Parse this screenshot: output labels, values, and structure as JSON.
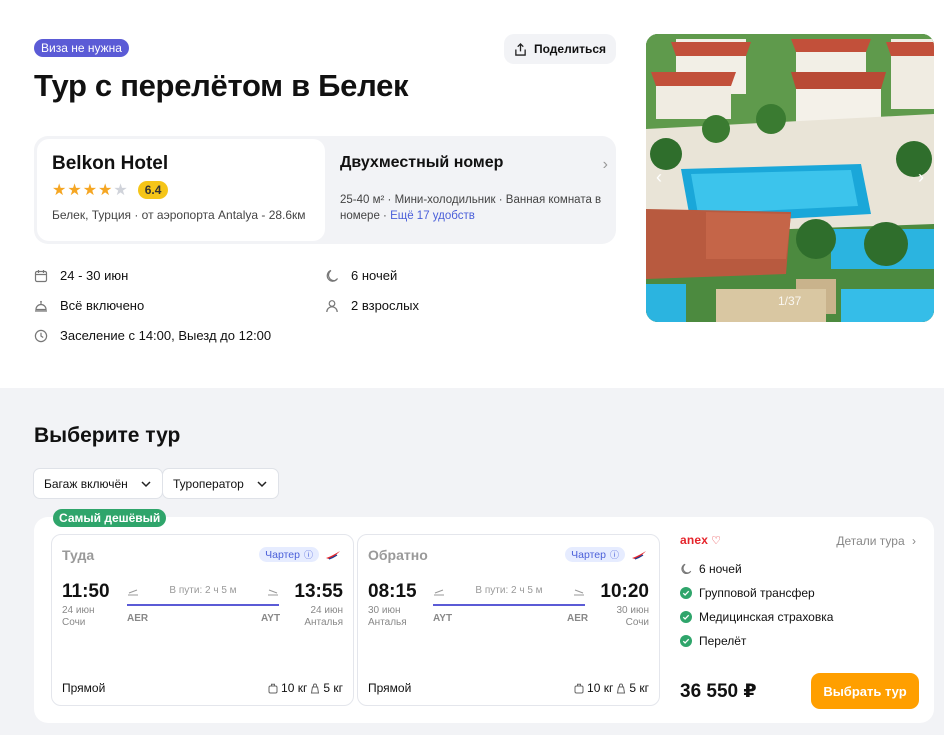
{
  "header": {
    "visa_badge": "Виза не нужна",
    "share_label": "Поделиться",
    "title": "Тур с перелётом в Белек"
  },
  "hotel": {
    "name": "Belkon Hotel",
    "stars": 4,
    "score": "6.4",
    "location": "Белек, Турция · от аэропорта Antalya - 28.6км"
  },
  "room": {
    "title": "Двухместный номер",
    "features": "25-40 м² · Мини-холодильник · Ванная комната в номере ·",
    "more_link": "Ещё 17 удобств"
  },
  "facts": {
    "dates": "24 - 30 июн",
    "nights": "6 ночей",
    "meals": "Всё включено",
    "guests": "2 взрослых",
    "checkin": "Заселение с 14:00, Выезд до 12:00"
  },
  "gallery": {
    "counter": "1/37"
  },
  "tours": {
    "section_title": "Выберите тур",
    "filters": [
      "Багаж включён",
      "Туроператор"
    ],
    "cheapest_badge": "Самый дешёвый",
    "legs": [
      {
        "heading": "Туда",
        "charter": "Чартер",
        "dep_time": "11:50",
        "dep_date": "24 июн",
        "dep_city": "Сочи",
        "dep_code": "AER",
        "duration": "В пути: 2 ч 5 м",
        "arr_time": "13:55",
        "arr_date": "24 июн",
        "arr_city": "Анталья",
        "arr_code": "AYT",
        "type": "Прямой",
        "bag_checked": "10 кг",
        "bag_hand": "5 кг"
      },
      {
        "heading": "Обратно",
        "charter": "Чартер",
        "dep_time": "08:15",
        "dep_date": "30 июн",
        "dep_city": "Анталья",
        "dep_code": "AYT",
        "duration": "В пути: 2 ч 5 м",
        "arr_time": "10:20",
        "arr_date": "30 июн",
        "arr_city": "Сочи",
        "arr_code": "AER",
        "type": "Прямой",
        "bag_checked": "10 кг",
        "bag_hand": "5 кг"
      }
    ],
    "operator": {
      "name": "anex",
      "details_label": "Детали тура",
      "nights": "6 ночей",
      "perks": [
        "Групповой трансфер",
        "Медицинская страховка",
        "Перелёт"
      ],
      "price": "36 550 ₽",
      "book_label": "Выбрать тур"
    }
  },
  "colors": {
    "accent": "#5b5bd6",
    "cta": "#ff9f00",
    "badge_green": "#2fa56b",
    "star": "#f5a623",
    "score": "#f5c518"
  }
}
